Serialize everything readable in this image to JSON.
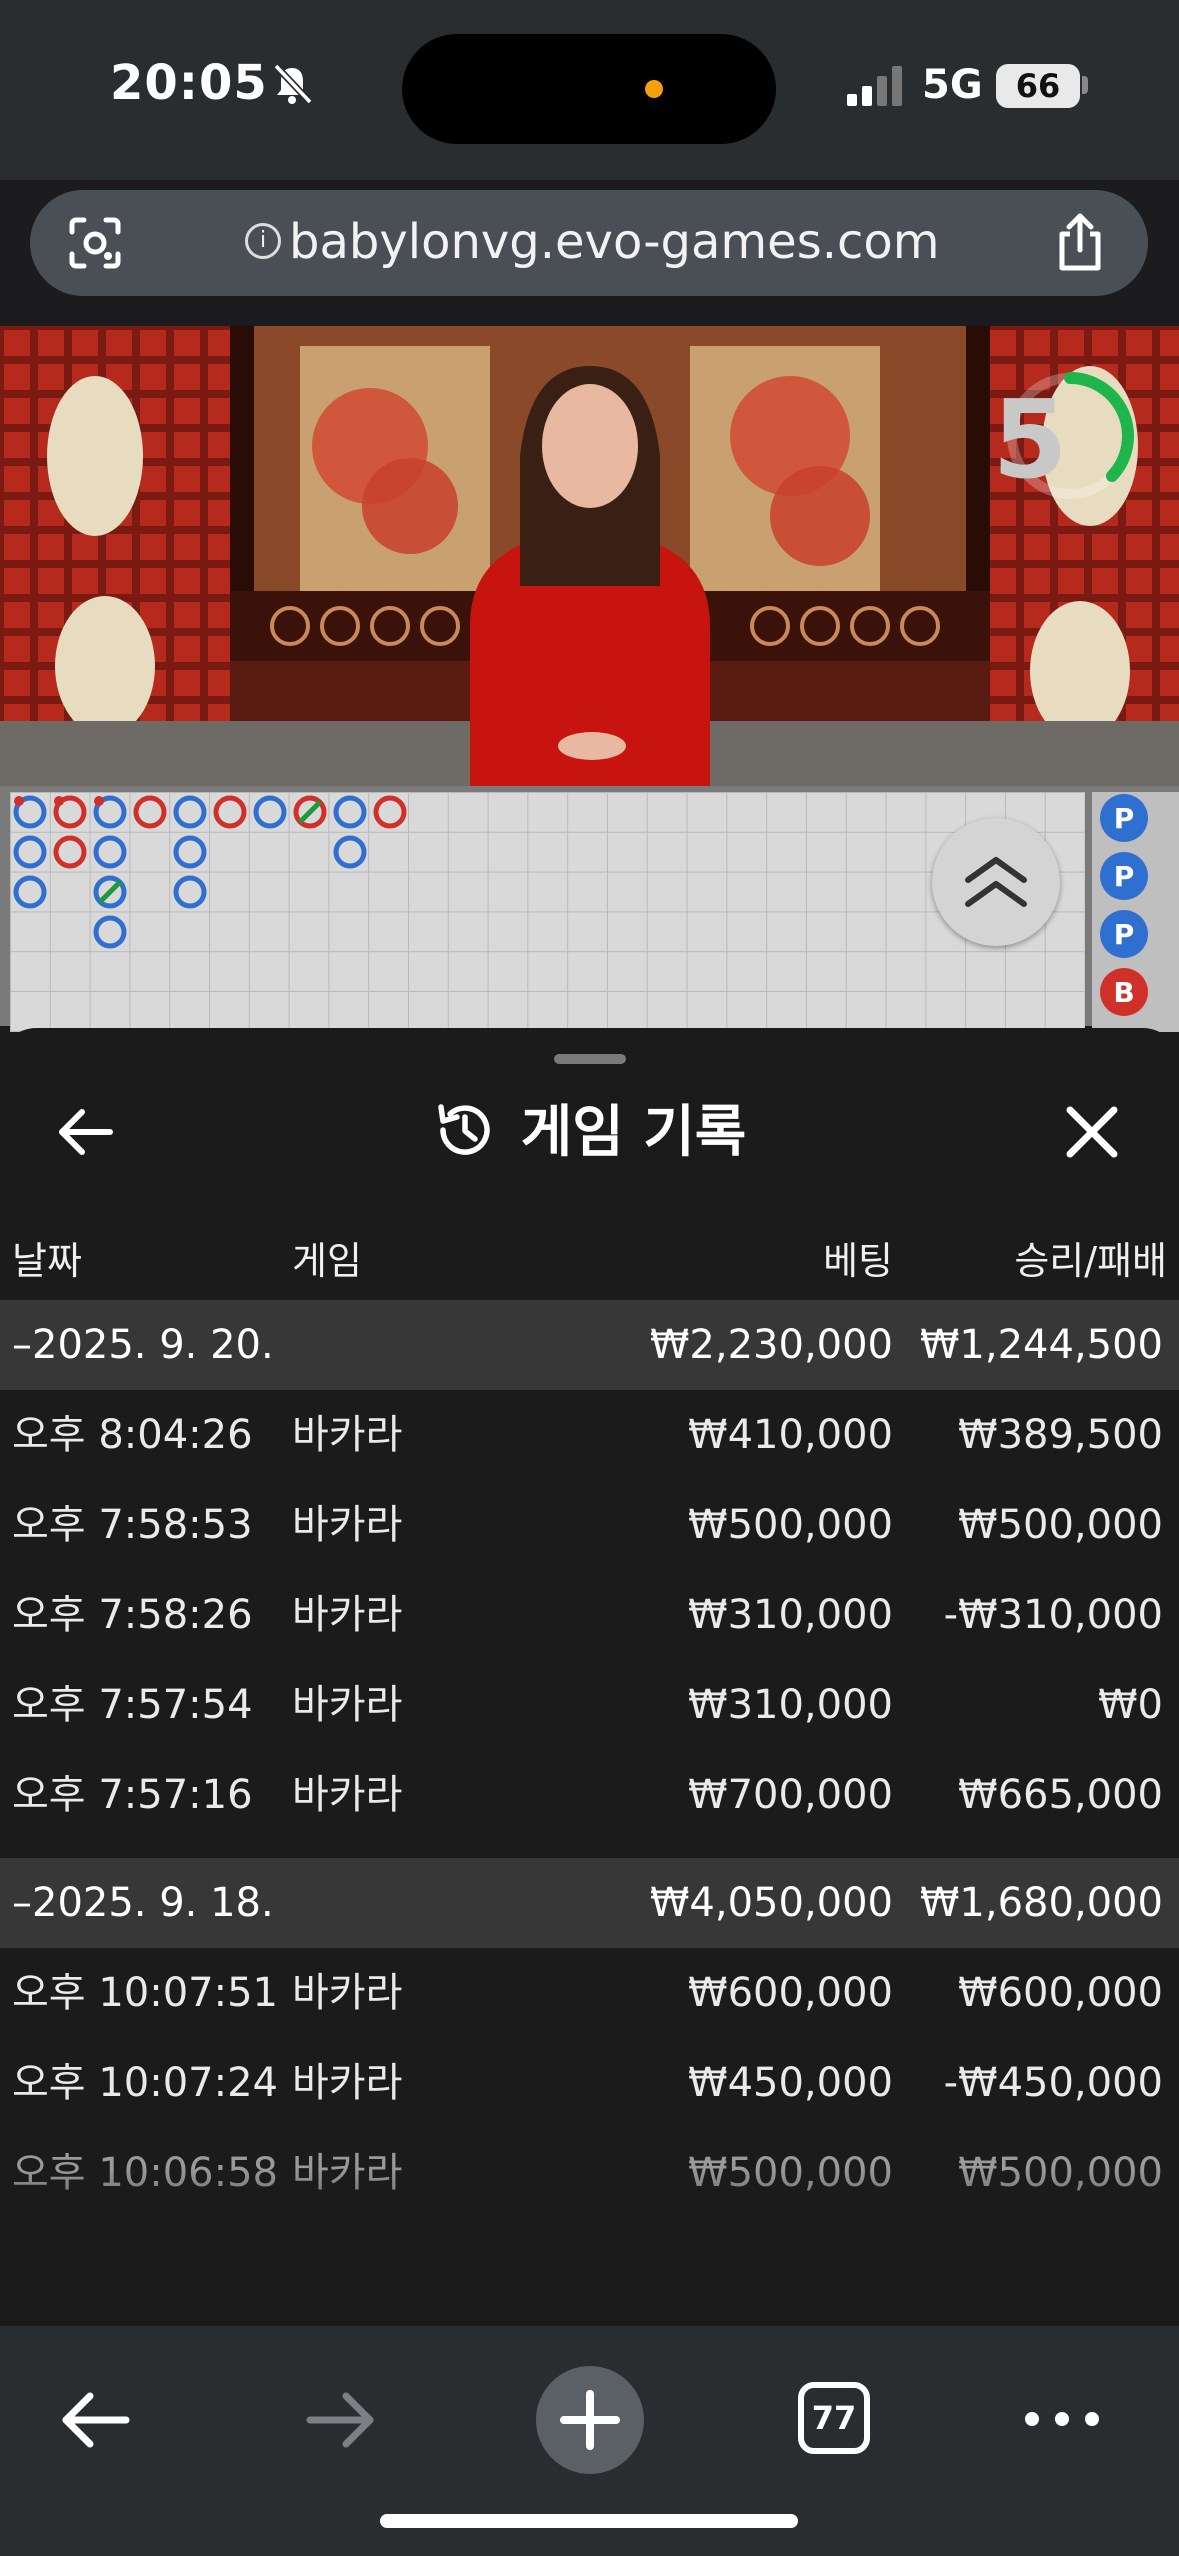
{
  "status_bar": {
    "time": "20:05",
    "network": "5G",
    "battery": "66"
  },
  "browser": {
    "url": "babylonvg.evo-games.com",
    "tab_count": "77"
  },
  "video": {
    "countdown": "5"
  },
  "sheet": {
    "title": "게임 기록",
    "columns": {
      "date": "날짜",
      "game": "게임",
      "bet": "베팅",
      "winloss": "승리/패배"
    },
    "groups": [
      {
        "date": "–2025. 9. 20.",
        "bet": "₩2,230,000",
        "winloss": "₩1,244,500",
        "rows": [
          {
            "time": "오후 8:04:26",
            "game": "바카라",
            "bet": "₩410,000",
            "winloss": "₩389,500"
          },
          {
            "time": "오후 7:58:53",
            "game": "바카라",
            "bet": "₩500,000",
            "winloss": "₩500,000"
          },
          {
            "time": "오후 7:58:26",
            "game": "바카라",
            "bet": "₩310,000",
            "winloss": "-₩310,000"
          },
          {
            "time": "오후 7:57:54",
            "game": "바카라",
            "bet": "₩310,000",
            "winloss": "₩0"
          },
          {
            "time": "오후 7:57:16",
            "game": "바카라",
            "bet": "₩700,000",
            "winloss": "₩665,000"
          }
        ]
      },
      {
        "date": "–2025. 9. 18.",
        "bet": "₩4,050,000",
        "winloss": "₩1,680,000",
        "rows": [
          {
            "time": "오후 10:07:51",
            "game": "바카라",
            "bet": "₩600,000",
            "winloss": "₩600,000"
          },
          {
            "time": "오후 10:07:24",
            "game": "바카라",
            "bet": "₩450,000",
            "winloss": "-₩450,000"
          },
          {
            "time": "오후 10:06:58",
            "game": "바카라",
            "bet": "₩500,000",
            "winloss": "₩500,000"
          }
        ]
      }
    ]
  },
  "roadmap": {
    "colors": {
      "player": "#2f6fd0",
      "banker": "#d0302a",
      "tie": "#1f9a3a"
    },
    "bead_labels": [
      "P",
      "P",
      "P",
      "B"
    ]
  },
  "icons": {
    "statusbar": [
      "bell-slash-icon",
      "signal-icon"
    ],
    "urlbar": [
      "lens-icon",
      "info-icon",
      "share-icon"
    ],
    "sheet": [
      "back-arrow-icon",
      "history-icon",
      "close-icon"
    ],
    "toolbar": [
      "back-icon",
      "forward-icon",
      "plus-icon",
      "tabs-icon",
      "more-icon"
    ]
  }
}
